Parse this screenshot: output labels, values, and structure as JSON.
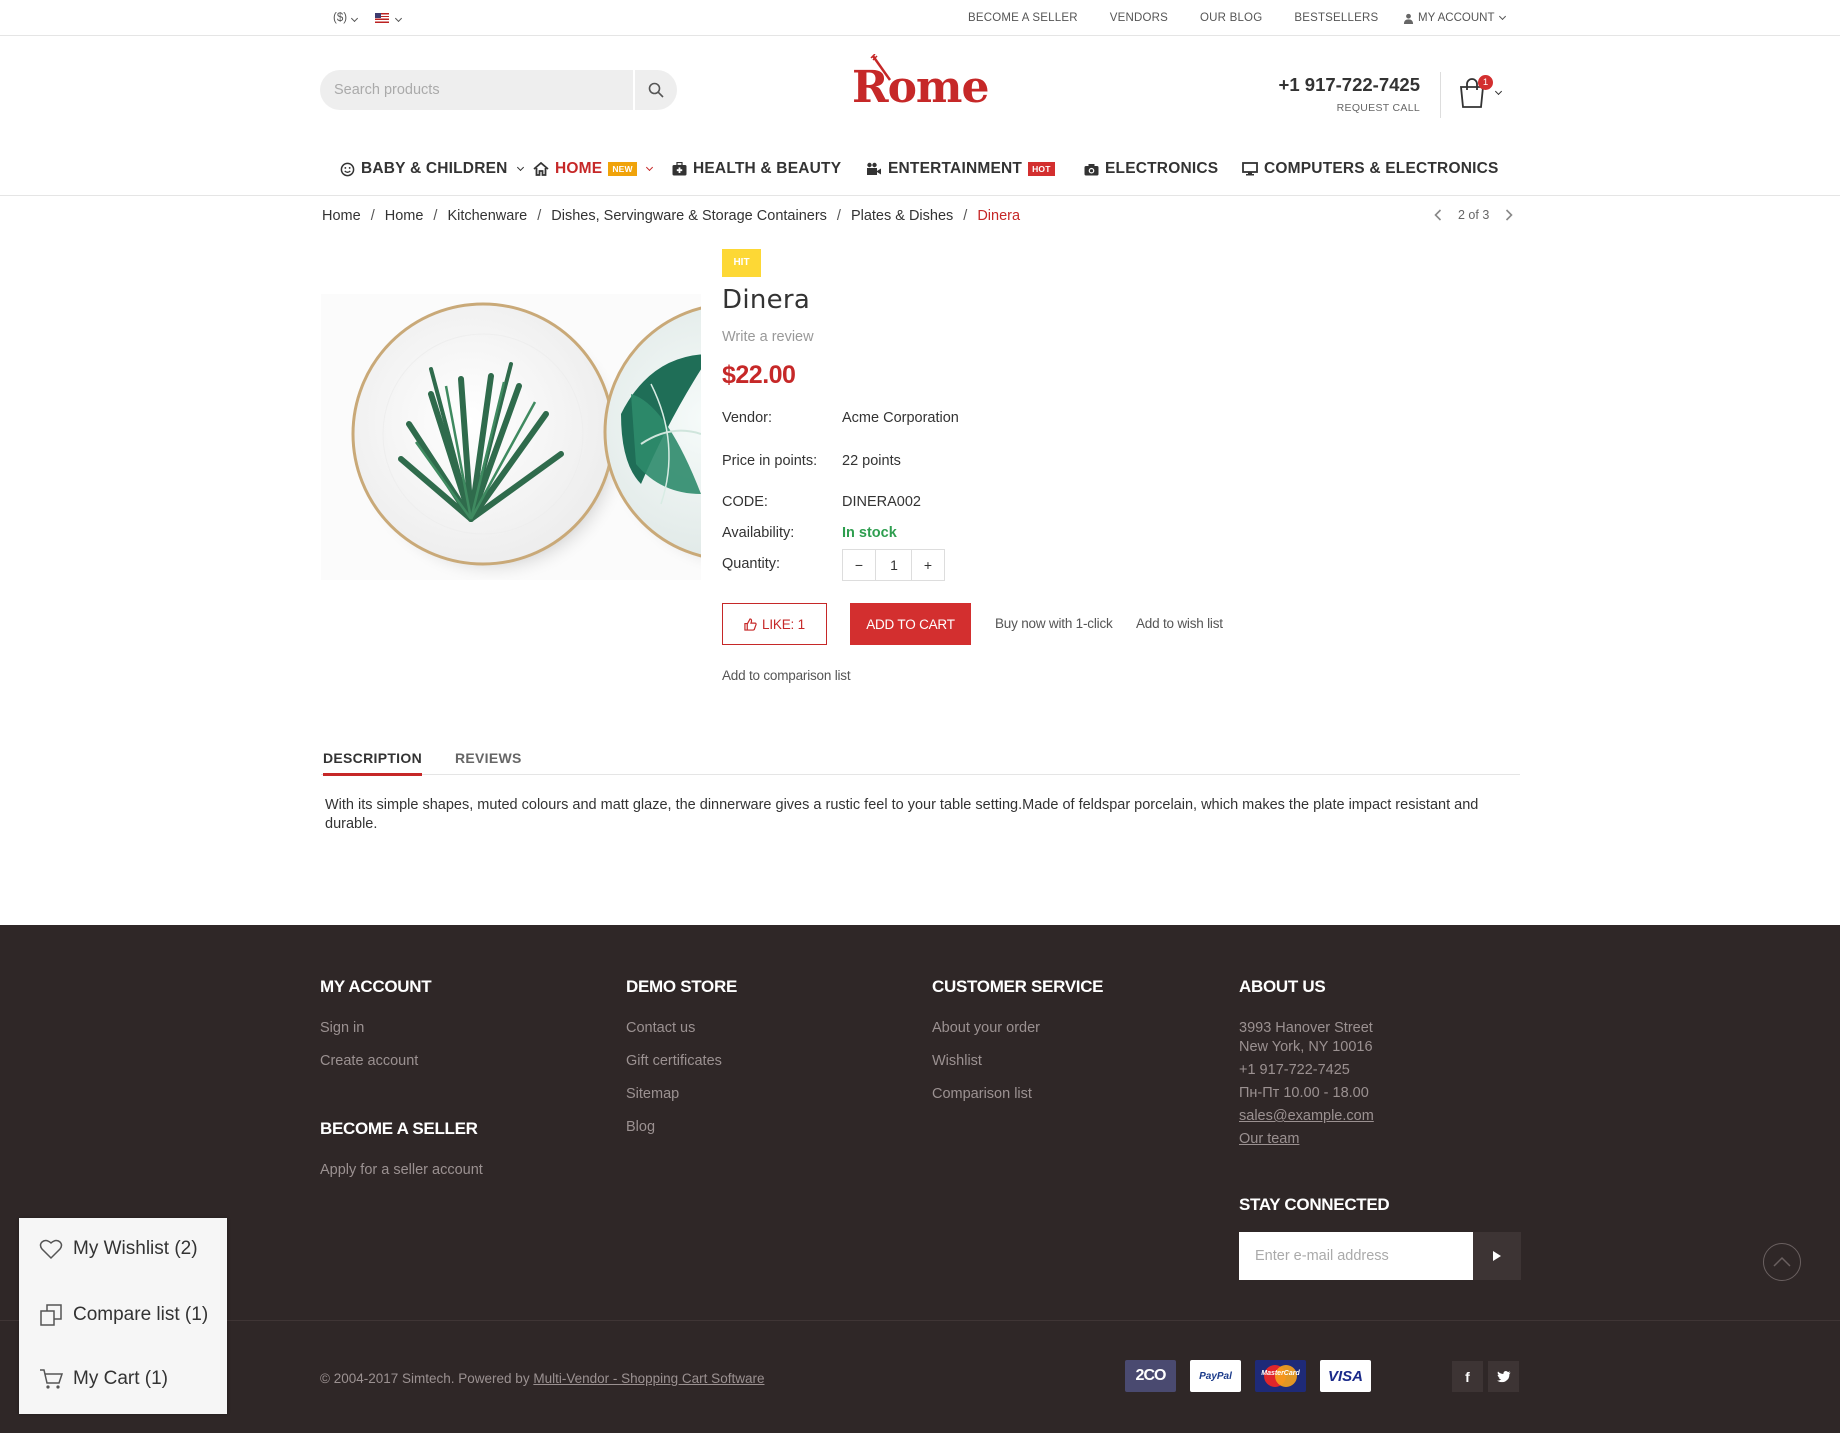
{
  "topbar": {
    "currency": "($)",
    "links": [
      "BECOME A SELLER",
      "VENDORS",
      "OUR BLOG",
      "BESTSELLERS"
    ],
    "account": "MY ACCOUNT"
  },
  "header": {
    "search_placeholder": "Search products",
    "logo": "Rome",
    "phone": "+1 917-722-7425",
    "request_call": "REQUEST CALL",
    "cart_count": "1"
  },
  "nav": {
    "items": [
      {
        "label": "BABY & CHILDREN",
        "icon": "smile-icon"
      },
      {
        "label": "HOME",
        "icon": "home-icon",
        "tag": "NEW"
      },
      {
        "label": "HEALTH & BEAUTY",
        "icon": "medkit-icon"
      },
      {
        "label": "ENTERTAINMENT",
        "icon": "entertainment-icon",
        "tag": "HOT"
      },
      {
        "label": "ELECTRONICS",
        "icon": "camera-icon"
      },
      {
        "label": "COMPUTERS & ELECTRONICS",
        "icon": "desktop-icon"
      }
    ]
  },
  "breadcrumb": {
    "items": [
      "Home",
      "Home",
      "Kitchenware",
      "Dishes, Servingware & Storage Containers",
      "Plates & Dishes"
    ],
    "current": "Dinera",
    "pager": "2 of 3"
  },
  "product": {
    "badge": "HIT",
    "title": "Dinera",
    "review_link": "Write a review",
    "price": "$22.00",
    "vendor_label": "Vendor:",
    "vendor": "Acme Corporation",
    "points_label": "Price in points:",
    "points": "22 points",
    "code_label": "CODE:",
    "code": "DINERA002",
    "availability_label": "Availability:",
    "availability": "In stock",
    "quantity_label": "Quantity:",
    "quantity": "1",
    "like_label": "LIKE: 1",
    "add_to_cart": "ADD TO CART",
    "buy_now": "Buy now with 1-click",
    "wishlist": "Add to wish list",
    "compare": "Add to comparison list"
  },
  "tabs": {
    "items": [
      "DESCRIPTION",
      "REVIEWS"
    ],
    "description": "With its simple shapes, muted colours and matt glaze, the dinnerware gives a rustic feel to your table setting.Made of feldspar porcelain, which makes the plate impact resistant and durable."
  },
  "footer": {
    "my_account": {
      "title": "MY ACCOUNT",
      "links": [
        "Sign in",
        "Create account"
      ]
    },
    "become_seller": {
      "title": "BECOME A SELLER",
      "links": [
        "Apply for a seller account"
      ]
    },
    "demo_store": {
      "title": "DEMO STORE",
      "links": [
        "Contact us",
        "Gift certificates",
        "Sitemap",
        "Blog"
      ]
    },
    "customer_service": {
      "title": "CUSTOMER SERVICE",
      "links": [
        "About your order",
        "Wishlist",
        "Comparison list"
      ]
    },
    "about": {
      "title": "ABOUT US",
      "address1": "3993 Hanover Street",
      "address2": "New York, NY 10016",
      "phone": "+1 917-722-7425",
      "hours": "Пн-Пт 10.00 - 18.00",
      "email": "sales@example.com",
      "team": "Our team"
    },
    "stay_connected": {
      "title": "STAY CONNECTED",
      "placeholder": "Enter e-mail address"
    },
    "copyright": "© 2004-2017 Simtech.  Powered by",
    "powered_link": "Multi-Vendor - Shopping Cart Software",
    "payments": [
      "2CO",
      "PayPal",
      "MasterCard",
      "VISA"
    ]
  },
  "floating": {
    "wishlist": "My Wishlist (2)",
    "compare": "Compare list (1)",
    "cart": "My Cart (1)"
  },
  "colors": {
    "accent": "#c62828",
    "footer_bg": "#2f2727",
    "stock_green": "#2e9e4f"
  }
}
